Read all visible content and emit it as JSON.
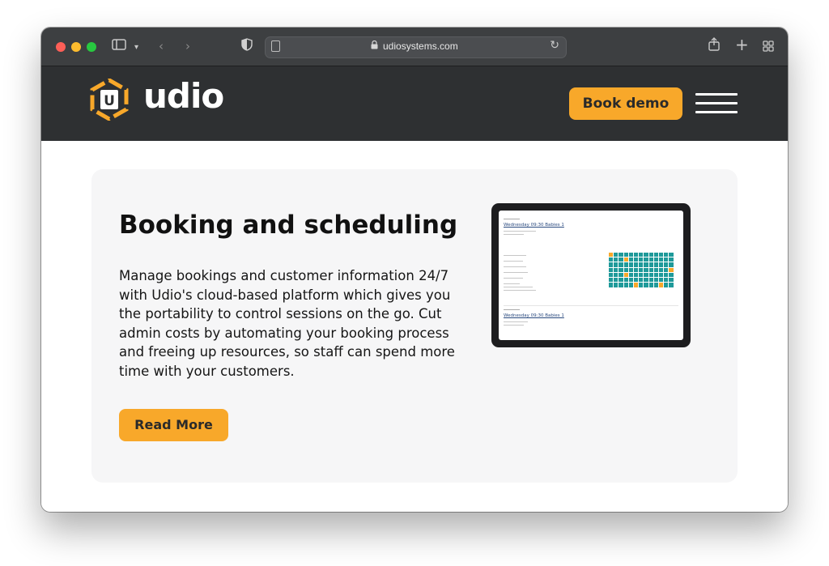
{
  "browser": {
    "url": "udiosystems.com"
  },
  "header": {
    "logo_letter": "U",
    "logo_text": "udio",
    "book_demo_label": "Book demo"
  },
  "feature": {
    "title": "Booking and scheduling",
    "description": "Manage bookings and customer information 24/7 with Udio's cloud-based platform which gives you the portability to control sessions on the go. Cut admin costs by automating your booking process and freeing up resources, so staff can spend more time with your customers.",
    "read_more_label": "Read More"
  },
  "tablet_screen": {
    "session1_title": "Wednesday 09:30 Babies 1",
    "session2_title": "Wednesday 09:30 Babies 1"
  },
  "colors": {
    "accent": "#f8a82a",
    "header_bg": "#2e3032",
    "grid_teal": "#1f9a9a"
  }
}
